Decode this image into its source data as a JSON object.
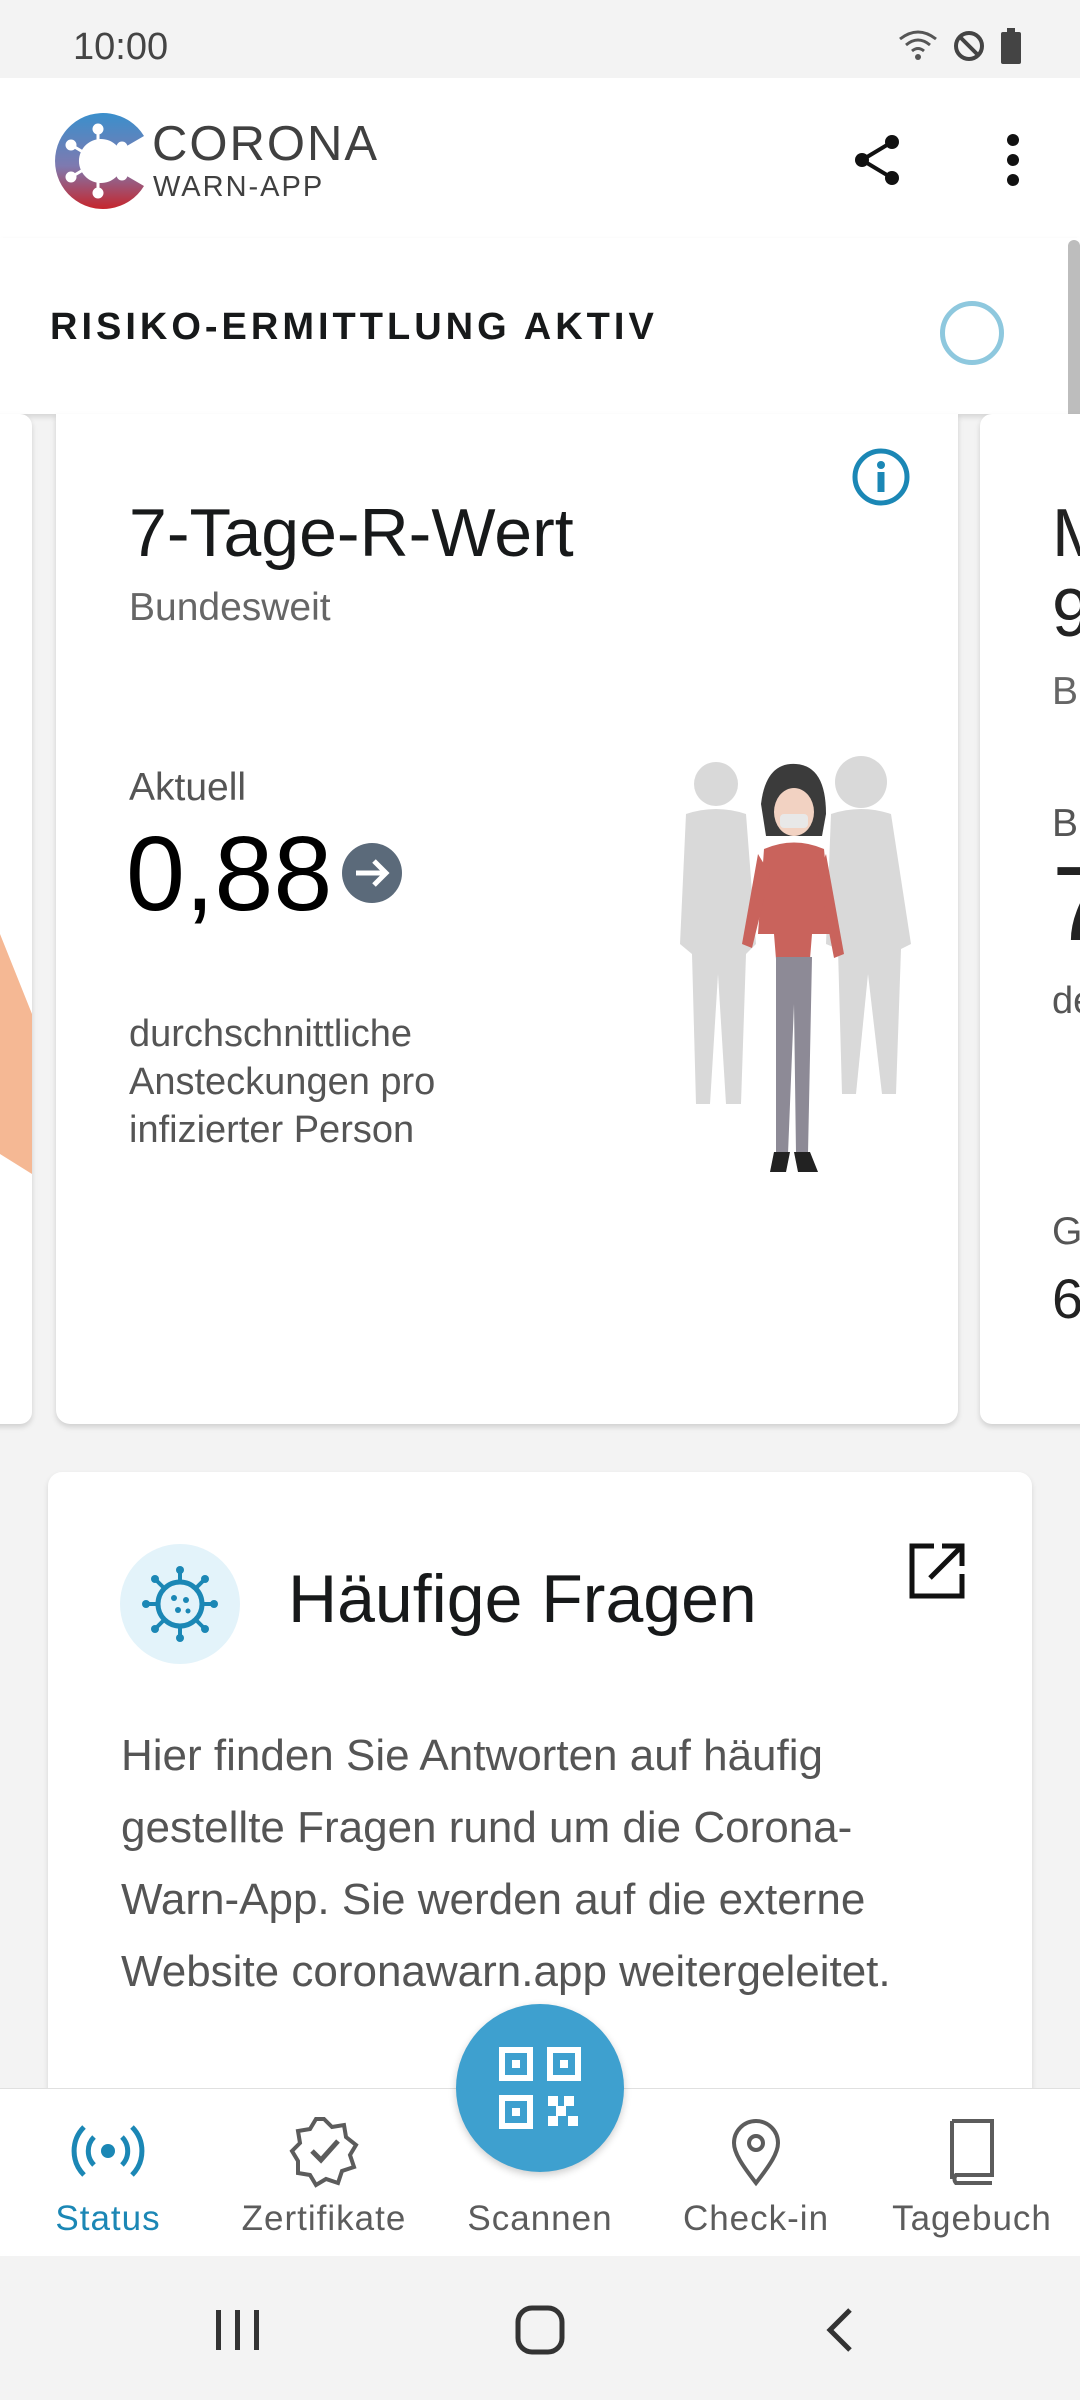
{
  "status_bar": {
    "time": "10:00"
  },
  "header": {
    "brand_line1": "CORONA",
    "brand_line2": "WARN-APP",
    "share_icon": "share-icon",
    "more_icon": "more-vert-icon"
  },
  "risk": {
    "label": "RISIKO-ERMITTLUNG AKTIV"
  },
  "card": {
    "title": "7-Tage-R-Wert",
    "subtitle": "Bundesweit",
    "current_label": "Aktuell",
    "value": "0,88",
    "description": "durchschnittliche Ansteckungen pro infizierter Person"
  },
  "right_peek": {
    "line1": "M",
    "line2": "9",
    "line3": "B",
    "line4": "B",
    "line5": "7",
    "line6": "de",
    "line7": "G",
    "line8": "6"
  },
  "faq": {
    "title": "Häufige Fragen",
    "text": "Hier finden Sie Antworten auf häufig gestellte Fragen rund um die Corona-Warn-App. Sie werden auf die externe Website coronawarn.app weitergeleitet."
  },
  "nav": {
    "items": [
      {
        "label": "Status",
        "icon": "broadcast-icon",
        "active": true
      },
      {
        "label": "Zertifikate",
        "icon": "certificate-icon",
        "active": false
      },
      {
        "label": "Scannen",
        "icon": "qr-code-icon",
        "active": false
      },
      {
        "label": "Check-in",
        "icon": "location-pin-icon",
        "active": false
      },
      {
        "label": "Tagebuch",
        "icon": "book-icon",
        "active": false
      }
    ]
  },
  "colors": {
    "accent": "#1b87b5",
    "fab": "#3ea0cf",
    "risk_circle": "#8ec8de"
  }
}
